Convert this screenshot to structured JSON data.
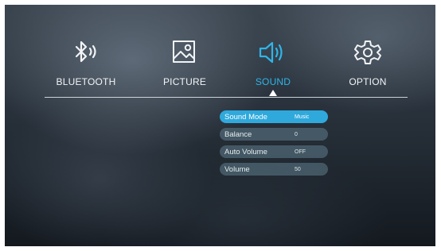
{
  "tabs": [
    {
      "label": "BLUETOOTH",
      "icon": "bluetooth-icon"
    },
    {
      "label": "PICTURE",
      "icon": "picture-icon"
    },
    {
      "label": "SOUND",
      "icon": "speaker-icon"
    },
    {
      "label": "OPTION",
      "icon": "gear-icon"
    }
  ],
  "active_tab": "SOUND",
  "sound_menu": [
    {
      "label": "Sound Mode",
      "value": "Music"
    },
    {
      "label": "Balance",
      "value": "0"
    },
    {
      "label": "Auto Volume",
      "value": "OFF"
    },
    {
      "label": "Volume",
      "value": "50"
    }
  ],
  "selected_item": "Sound Mode",
  "colors": {
    "accent": "#2fb5e8",
    "row": "#4f6f7d",
    "selected_row": "#2fa9dc"
  }
}
